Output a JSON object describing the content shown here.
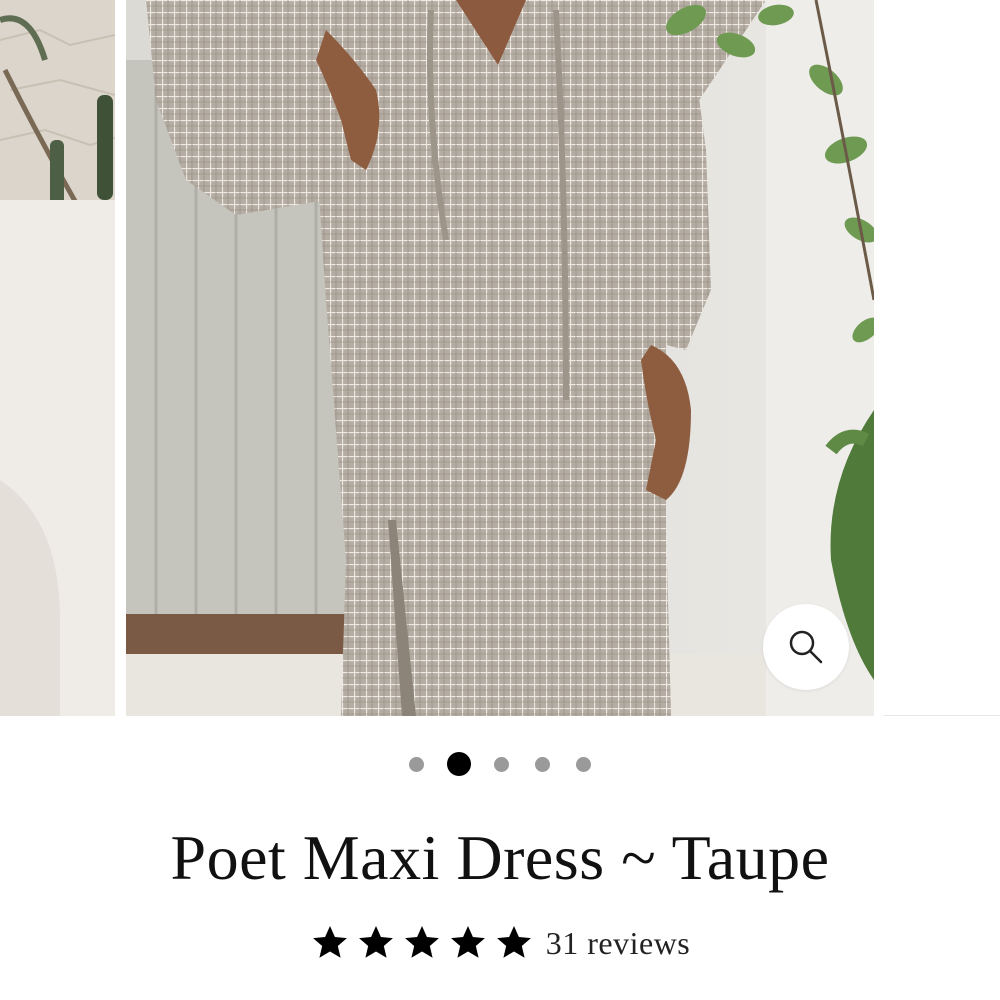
{
  "product": {
    "title": "Poet Maxi Dress ~ Taupe",
    "rating": 5,
    "rating_max": 5,
    "reviews_count": "31",
    "reviews_label": "reviews"
  },
  "gallery": {
    "total_images": 5,
    "active_index": 2,
    "zoom_icon": "search-icon"
  },
  "colors": {
    "dress": "#b8b0a6",
    "check_line": "#f2eee8",
    "star": "#000000",
    "dot_inactive": "#9a9a9a",
    "dot_active": "#000000"
  }
}
